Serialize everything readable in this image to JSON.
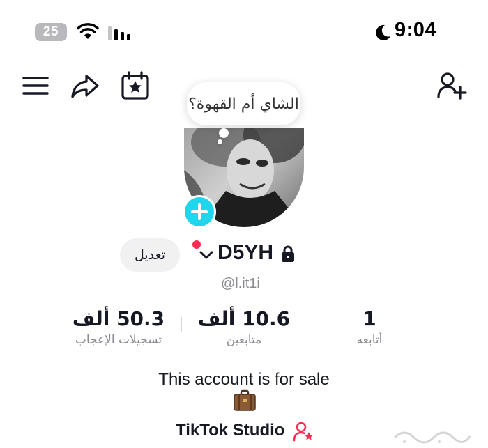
{
  "status_bar": {
    "battery": "25",
    "time": "9:04"
  },
  "header": {
    "icons": [
      "menu-icon",
      "share-icon",
      "calendar-star-icon",
      "add-friend-icon"
    ]
  },
  "bubble": {
    "text": "الشاي أم القهوة؟"
  },
  "profile": {
    "edit_label": "تعديل",
    "username": "D5YH",
    "handle": "@l.it1i"
  },
  "stats": {
    "likes": {
      "value": "50.3 ألف",
      "label": "تسجيلات الإعجاب"
    },
    "followers": {
      "value": "10.6 ألف",
      "label": "متابعين"
    },
    "following": {
      "value": "1",
      "label": "أتابعه"
    }
  },
  "bio": {
    "text": "This account is for sale",
    "emoji_icon": "suitcase-icon"
  },
  "studio": {
    "label": "TikTok Studio"
  },
  "colors": {
    "accent_plus": "#20d5ec",
    "live_dot": "#fe2c55",
    "studio_icon": "#fe2c55"
  }
}
